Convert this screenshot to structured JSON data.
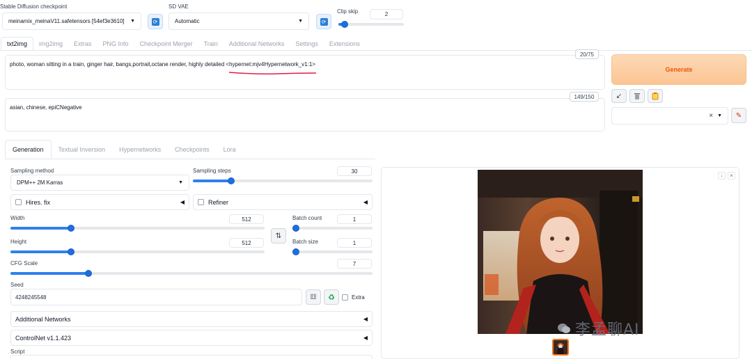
{
  "top": {
    "checkpoint_label": "Stable Diffusion checkpoint",
    "checkpoint_value": "meinamix_meinaV11.safetensors [54ef3e3610]",
    "vae_label": "SD VAE",
    "vae_value": "Automatic",
    "clip_skip_label": "Clip skip",
    "clip_skip_value": "2",
    "clip_skip_level": 0.05
  },
  "main_tabs": [
    "txt2img",
    "img2img",
    "Extras",
    "PNG Info",
    "Checkpoint Merger",
    "Train",
    "Additional Networks",
    "Settings",
    "Extensions"
  ],
  "prompt": {
    "text_plain": "photo, woman sitting in a train, ginger hair, bangs,portrait,octane render, highly detailed ",
    "text_highlight": "<hypernet:mjv4Hypernetwork_v1:1>",
    "counter": "20/75"
  },
  "negative": {
    "text": "asian, chinese,  epiCNegative",
    "counter": "149/150"
  },
  "generate_label": "Generate",
  "tool_icons": [
    "arrow-down-left-icon",
    "trash-icon",
    "clipboard-icon"
  ],
  "styles_clear": "×",
  "sub_tabs": [
    "Generation",
    "Textual Inversion",
    "Hypernetworks",
    "Checkpoints",
    "Lora"
  ],
  "sampling": {
    "method_label": "Sampling method",
    "method_value": "DPM++ 2M Karras",
    "steps_label": "Sampling steps",
    "steps_value": "30",
    "steps_level": 0.2
  },
  "hires_label": "Hires. fix",
  "refiner_label": "Refiner",
  "width": {
    "label": "Width",
    "value": "512",
    "level": 0.23
  },
  "height": {
    "label": "Height",
    "value": "512",
    "level": 0.23
  },
  "swap_icon": "⇅",
  "batch_count": {
    "label": "Batch count",
    "value": "1",
    "level": 0.0
  },
  "batch_size": {
    "label": "Batch size",
    "value": "1",
    "level": 0.0
  },
  "cfg": {
    "label": "CFG Scale",
    "value": "7",
    "level": 0.21
  },
  "seed": {
    "label": "Seed",
    "value": "4248245548",
    "extra_label": "Extra"
  },
  "additional_networks_label": "Additional Networks",
  "controlnet_label": "ControlNet v1.1.423",
  "script_label": "Script",
  "watermark": "李孟聊AI",
  "accent": "#f97316",
  "slider_color": "#2f80ed"
}
